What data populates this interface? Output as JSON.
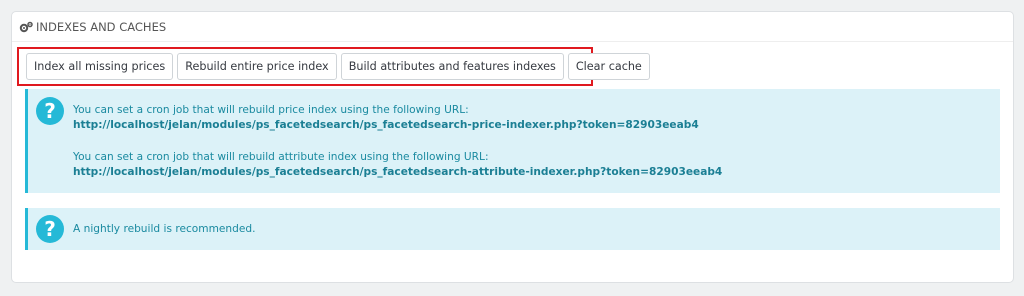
{
  "panel": {
    "title": "Indexes and caches"
  },
  "buttons": [
    {
      "label": "Index all missing prices"
    },
    {
      "label": "Rebuild entire price index"
    },
    {
      "label": "Build attributes and features indexes"
    },
    {
      "label": "Clear cache"
    }
  ],
  "alerts": [
    {
      "icon": "question-icon",
      "paragraphs": [
        {
          "text": "You can set a cron job that will rebuild price index using the following URL:",
          "url": "http://localhost/jelan/modules/ps_facetedsearch/ps_facetedsearch-price-indexer.php?token=82903eeab4"
        },
        {
          "text": "You can set a cron job that will rebuild attribute index using the following URL:",
          "url": "http://localhost/jelan/modules/ps_facetedsearch/ps_facetedsearch-attribute-indexer.php?token=82903eeab4"
        }
      ]
    },
    {
      "icon": "question-icon",
      "text": "A nightly rebuild is recommended."
    }
  ],
  "colors": {
    "accent": "#25b9d7",
    "alert_bg": "#dcf2f8",
    "highlight_border": "#e0191f"
  }
}
